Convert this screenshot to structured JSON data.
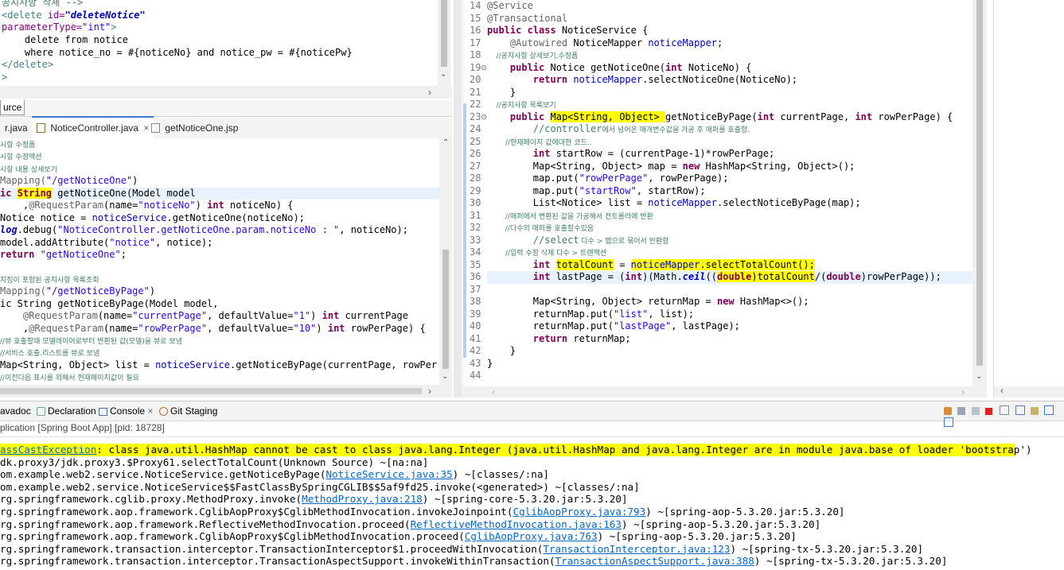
{
  "xml_editor": {
    "lines": [
      [
        [
          "공지사항 삭제 -->",
          "cm"
        ]
      ],
      [
        [
          "<",
          "tag"
        ],
        [
          "delete",
          "tag"
        ],
        [
          " id=",
          "attr"
        ],
        [
          "\"deleteNotice\"",
          "sit"
        ]
      ],
      [
        [
          "parameterType=",
          "attr"
        ],
        [
          "\"int\"",
          "str"
        ],
        [
          ">",
          "tag"
        ]
      ],
      [
        [
          "    delete from notice",
          ""
        ]
      ],
      [
        [
          "    where notice_no = #{noticeNo} and notice_pw = #{noticePw}",
          ""
        ]
      ],
      [
        [
          "</",
          "tag"
        ],
        [
          "delete",
          "tag"
        ],
        [
          ">",
          "tag"
        ]
      ],
      [
        [
          ">",
          "tag"
        ]
      ]
    ]
  },
  "source_tab": {
    "label": "urce"
  },
  "controller_tabs": [
    {
      "label": "r.java"
    },
    {
      "label": "NoticeController.java",
      "close": "×"
    },
    {
      "label": "getNoticeOne.jsp"
    }
  ],
  "controller_editor": {
    "lines": [
      [
        [
          "시항 수정폼",
          "cmk"
        ]
      ],
      [
        [
          "시항 수정액션",
          "cmk"
        ]
      ],
      [
        [
          "시항 내용 상세보기",
          "cmk"
        ]
      ],
      [
        [
          "Mapping(",
          "ann"
        ],
        [
          "\"/getNoticeOne\"",
          "str"
        ],
        [
          ")",
          ""
        ]
      ],
      [
        [
          "ic ",
          "kw"
        ],
        [
          "String",
          "kw hl"
        ],
        [
          " getNoticeOne(Model model",
          ""
        ]
      ],
      [
        [
          "    ,",
          ""
        ],
        [
          "@RequestParam",
          "ann"
        ],
        [
          "(name=",
          ""
        ],
        [
          "\"noticeNo\"",
          "str"
        ],
        [
          ") ",
          ""
        ],
        [
          "int",
          "kw"
        ],
        [
          " noticeNo) {",
          ""
        ]
      ],
      [
        [
          "Notice notice = ",
          ""
        ],
        [
          "noticeService",
          "fld"
        ],
        [
          ".getNoticeOne(noticeNo);",
          ""
        ]
      ],
      [
        [
          "log",
          "sit"
        ],
        [
          ".debug(",
          ""
        ],
        [
          "\"NoticeController.getNoticeOne.param.noticeNo : \"",
          "str"
        ],
        [
          ", noticeNo);",
          ""
        ]
      ],
      [
        [
          "model.addAttribute(",
          ""
        ],
        [
          "\"notice\"",
          "str"
        ],
        [
          ", notice);",
          ""
        ]
      ],
      [
        [
          "return",
          "kw"
        ],
        [
          " ",
          ""
        ],
        [
          "\"getNoticeOne\"",
          "str"
        ],
        [
          ";",
          ""
        ]
      ],
      [
        [
          "",
          ""
        ]
      ],
      [
        [
          "지징이 포함된 공지사항 목록조회",
          "cmk"
        ]
      ],
      [
        [
          "Mapping(",
          "ann"
        ],
        [
          "\"/getNoticeByPage\"",
          "str"
        ],
        [
          ")",
          ""
        ]
      ],
      [
        [
          "ic String getNoticeByPage(Model model,",
          ""
        ]
      ],
      [
        [
          "    ",
          ""
        ],
        [
          "@RequestParam",
          "ann"
        ],
        [
          "(name=",
          ""
        ],
        [
          "\"currentPage\"",
          "str"
        ],
        [
          ", defaultValue=",
          ""
        ],
        [
          "\"1\"",
          "str"
        ],
        [
          ") ",
          ""
        ],
        [
          "int",
          "kw"
        ],
        [
          " currentPage",
          ""
        ]
      ],
      [
        [
          "    ,",
          ""
        ],
        [
          "@RequestParam",
          "ann"
        ],
        [
          "(name=",
          ""
        ],
        [
          "\"rowPerPage\"",
          "str"
        ],
        [
          ", defaultValue=",
          ""
        ],
        [
          "\"10\"",
          "str"
        ],
        [
          ") ",
          ""
        ],
        [
          "int",
          "kw"
        ],
        [
          " rowPerPage) {",
          ""
        ]
      ],
      [
        [
          "//뷰 호출할때 모델레이어로부터 반환된 값(모델)을 뷰로 보냄",
          "cmk"
        ]
      ],
      [
        [
          "//서비스 호출.리스트를 뷰로 보냄",
          "cmk"
        ]
      ],
      [
        [
          "Map<String, Object> list = ",
          ""
        ],
        [
          "noticeService",
          "fld"
        ],
        [
          ".getNoticeByPage(currentPage, rowPer",
          ""
        ]
      ],
      [
        [
          "//이전다음 표시를 위해서 현재페이지값이 필요",
          "cmk"
        ]
      ]
    ]
  },
  "service_editor": {
    "numbers": [
      "14",
      "15",
      "16",
      "17",
      "18",
      "19⊝",
      "20",
      "21",
      "22",
      "23⊝",
      "24",
      "25",
      "26",
      "27",
      "28",
      "29",
      "30",
      "31",
      "32",
      "33",
      "34",
      "35",
      "36",
      "37",
      "38",
      "39",
      "40",
      "41",
      "42",
      "43",
      "44"
    ],
    "lines": [
      [
        [
          "@Service",
          "ann"
        ]
      ],
      [
        [
          "@Transactional",
          "ann"
        ]
      ],
      [
        [
          "public",
          "kw"
        ],
        [
          " ",
          ""
        ],
        [
          "class",
          "kw"
        ],
        [
          " NoticeService {",
          ""
        ]
      ],
      [
        [
          "    ",
          ""
        ],
        [
          "@Autowired",
          "ann"
        ],
        [
          " NoticeMapper ",
          ""
        ],
        [
          "noticeMapper",
          "fld"
        ],
        [
          ";",
          ""
        ]
      ],
      [
        [
          "    //공지사항 상세보기,수정폼",
          "cmk"
        ]
      ],
      [
        [
          "    ",
          ""
        ],
        [
          "public",
          "kw"
        ],
        [
          " Notice getNoticeOne(",
          ""
        ],
        [
          "int",
          "kw"
        ],
        [
          " NoticeNo) {",
          ""
        ]
      ],
      [
        [
          "        ",
          ""
        ],
        [
          "return",
          "kw"
        ],
        [
          " ",
          ""
        ],
        [
          "noticeMapper",
          "fld"
        ],
        [
          ".selectNoticeOne(NoticeNo);",
          ""
        ]
      ],
      [
        [
          "    }",
          ""
        ]
      ],
      [
        [
          "    //공지사항 목록보기",
          "cmk"
        ]
      ],
      [
        [
          "    ",
          ""
        ],
        [
          "public",
          "kw"
        ],
        [
          " ",
          ""
        ],
        [
          "Map<String, Object> ",
          "hl"
        ],
        [
          "getNoticeByPage(",
          ""
        ],
        [
          "int",
          "kw"
        ],
        [
          " currentPage, ",
          ""
        ],
        [
          "int",
          "kw"
        ],
        [
          " rowPerPage) {",
          ""
        ]
      ],
      [
        [
          "        //",
          "cm"
        ],
        [
          "controller",
          "cm"
        ],
        [
          "에서 넘어온 매개변수값을 가공 후 매퍼를 호출함.",
          "cmk"
        ]
      ],
      [
        [
          "        //현재페이지 값에대한 코드..",
          "cmk"
        ]
      ],
      [
        [
          "        ",
          ""
        ],
        [
          "int",
          "kw"
        ],
        [
          " startRow = (currentPage-1)*rowPerPage;",
          ""
        ]
      ],
      [
        [
          "        Map<String, Object> map = ",
          ""
        ],
        [
          "new",
          "kw"
        ],
        [
          " HashMap<String, Object>();",
          ""
        ]
      ],
      [
        [
          "        map.put(",
          ""
        ],
        [
          "\"rowPerPage\"",
          "str"
        ],
        [
          ", rowPerPage);",
          ""
        ]
      ],
      [
        [
          "        map.put(",
          ""
        ],
        [
          "\"startRow\"",
          "str"
        ],
        [
          ", startRow);",
          ""
        ]
      ],
      [
        [
          "        List<Notice> list = ",
          ""
        ],
        [
          "noticeMapper",
          "fld"
        ],
        [
          ".selectNoticeByPage(map);",
          ""
        ]
      ],
      [
        [
          "        //매퍼에서 변환된 값을 가공해서 컨트롤러에 반환",
          "cmk"
        ]
      ],
      [
        [
          "        //다수의 매퍼를 호출할수있음",
          "cmk"
        ]
      ],
      [
        [
          "        //",
          "cm"
        ],
        [
          "select",
          "cm"
        ],
        [
          " 다수 > 맵으로 묶어서 반환함",
          "cmk"
        ]
      ],
      [
        [
          "        //입력 수정 삭제 다수 > 트랜잭션",
          "cmk"
        ]
      ],
      [
        [
          "        ",
          ""
        ],
        [
          "int",
          "kw"
        ],
        [
          " ",
          ""
        ],
        [
          "totalCount",
          "hl"
        ],
        [
          " = ",
          ""
        ],
        [
          "noticeMapper",
          "fld hl"
        ],
        [
          ".selectTotalCount();",
          "hl"
        ]
      ],
      [
        [
          "        ",
          ""
        ],
        [
          "int",
          "kw"
        ],
        [
          " lastPage = (",
          ""
        ],
        [
          "int",
          "kw"
        ],
        [
          ")(Math.",
          ""
        ],
        [
          "ceil",
          "sit"
        ],
        [
          "((",
          ""
        ],
        [
          "double",
          "kw hl"
        ],
        [
          ")",
          "hl"
        ],
        [
          "totalCount",
          "hl"
        ],
        [
          "/(",
          ""
        ],
        [
          "double",
          "kw"
        ],
        [
          ")rowPerPage));",
          ""
        ]
      ],
      [
        [
          "",
          ""
        ]
      ],
      [
        [
          "        Map<String, Object> returnMap = ",
          ""
        ],
        [
          "new",
          "kw"
        ],
        [
          " HashMap<>();",
          ""
        ]
      ],
      [
        [
          "        returnMap.put(",
          ""
        ],
        [
          "\"list\"",
          "str"
        ],
        [
          ", list);",
          ""
        ]
      ],
      [
        [
          "        returnMap.put(",
          ""
        ],
        [
          "\"lastPage\"",
          "str"
        ],
        [
          ", lastPage);",
          ""
        ]
      ],
      [
        [
          "        ",
          ""
        ],
        [
          "return",
          "kw"
        ],
        [
          " returnMap;",
          ""
        ]
      ],
      [
        [
          "    }",
          ""
        ]
      ],
      [
        [
          "}",
          ""
        ]
      ],
      [
        [
          "",
          ""
        ]
      ]
    ]
  },
  "console": {
    "tabs": [
      "avadoc",
      "Declaration",
      "Console",
      "Git Staging"
    ],
    "console_close": "×",
    "launch": "plication [Spring Boot App]  [pid: 18728]",
    "lines": [
      [
        [
          "assCastException",
          "lnk"
        ],
        [
          ": class java.util.HashMap cannot be cast to class java.lang.Integer (java.util.HashMap and java.lang.Integer are in module java.base of loader 'bootstrap')",
          ""
        ]
      ],
      [
        [
          "dk.proxy3/jdk.proxy3.$Proxy61.selectTotalCount(Unknown Source) ~[na:na]",
          ""
        ]
      ],
      [
        [
          "om.example.web2.service.NoticeService.getNoticeByPage(",
          ""
        ],
        [
          "NoticeService.java:35",
          "lnk"
        ],
        [
          ") ~[classes/:na]",
          ""
        ]
      ],
      [
        [
          "om.example.web2.service.NoticeService$$FastClassBySpringCGLIB$$5af9fd25.invoke(<generated>) ~[classes/:na]",
          ""
        ]
      ],
      [
        [
          "rg.springframework.cglib.proxy.MethodProxy.invoke(",
          ""
        ],
        [
          "MethodProxy.java:218",
          "lnk"
        ],
        [
          ") ~[spring-core-5.3.20.jar:5.3.20]",
          ""
        ]
      ],
      [
        [
          "rg.springframework.aop.framework.CglibAopProxy$CglibMethodInvocation.invokeJoinpoint(",
          ""
        ],
        [
          "CglibAopProxy.java:793",
          "lnk"
        ],
        [
          ") ~[spring-aop-5.3.20.jar:5.3.20]",
          ""
        ]
      ],
      [
        [
          "rg.springframework.aop.framework.ReflectiveMethodInvocation.proceed(",
          ""
        ],
        [
          "ReflectiveMethodInvocation.java:163",
          "lnk"
        ],
        [
          ") ~[spring-aop-5.3.20.jar:5.3.20]",
          ""
        ]
      ],
      [
        [
          "rg.springframework.aop.framework.CglibAopProxy$CglibMethodInvocation.proceed(",
          ""
        ],
        [
          "CglibAopProxy.java:763",
          "lnk"
        ],
        [
          ") ~[spring-aop-5.3.20.jar:5.3.20]",
          ""
        ]
      ],
      [
        [
          "rg.springframework.transaction.interceptor.TransactionInterceptor$1.proceedWithInvocation(",
          ""
        ],
        [
          "TransactionInterceptor.java:123",
          "lnk"
        ],
        [
          ") ~[spring-tx-5.3.20.jar:5.3.20]",
          ""
        ]
      ],
      [
        [
          "rg.springframework.transaction.interceptor.TransactionAspectSupport.invokeWithinTransaction(",
          ""
        ],
        [
          "TransactionAspectSupport.java:388",
          "lnk"
        ],
        [
          ") ~[spring-tx-5.3.20.jar:5.3.20]",
          ""
        ]
      ]
    ]
  }
}
